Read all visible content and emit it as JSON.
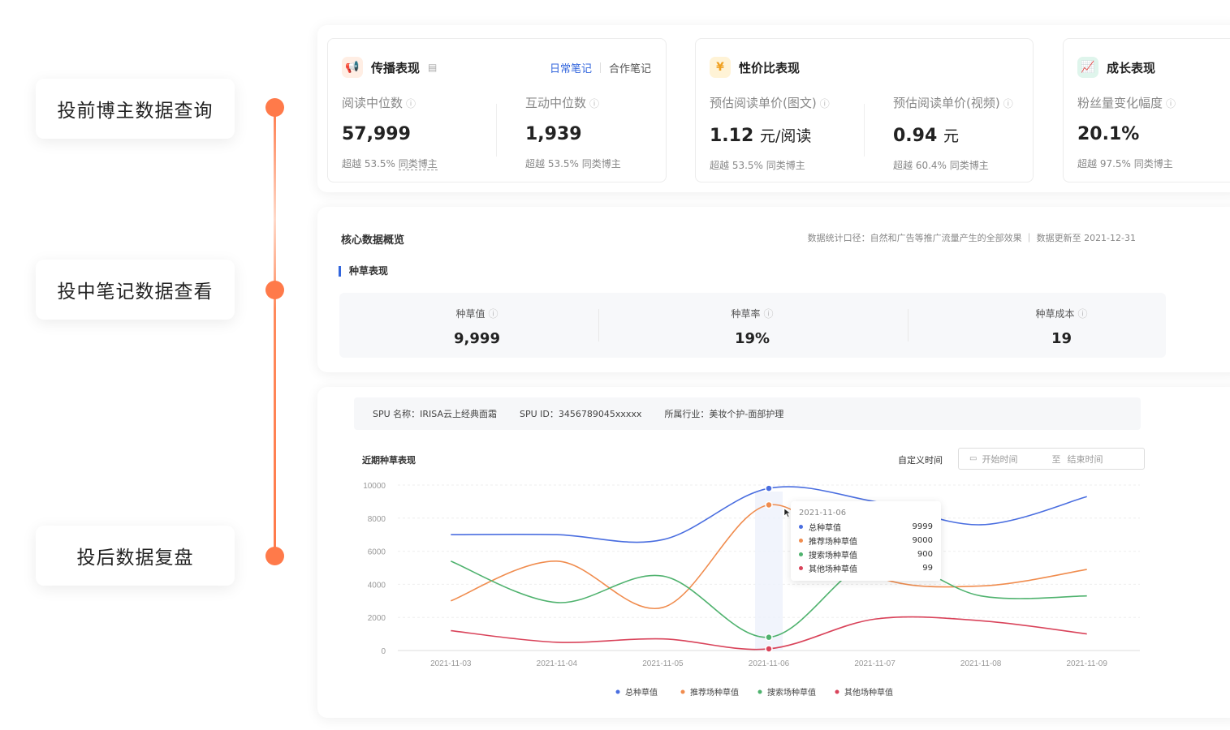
{
  "steps": [
    "投前博主数据查询",
    "投中笔记数据查看",
    "投后数据复盘"
  ],
  "cards": {
    "spread": {
      "title": "传播表现",
      "tab_active": "日常笔记",
      "tab_other": "合作笔记",
      "metrics": [
        {
          "label": "阅读中位数",
          "value": "57,999",
          "sub_prefix": "超越 53.5%",
          "sub_suffix": "同类博主"
        },
        {
          "label": "互动中位数",
          "value": "1,939",
          "sub_prefix": "超越 53.5%",
          "sub_suffix": "同类博主"
        }
      ]
    },
    "cost": {
      "title": "性价比表现",
      "icon": "¥",
      "metrics": [
        {
          "label": "预估阅读单价(图文)",
          "value": "1.12",
          "unit": "元/阅读",
          "sub_prefix": "超越 53.5%",
          "sub_suffix": "同类博主"
        },
        {
          "label": "预估阅读单价(视频)",
          "value": "0.94",
          "unit": "元",
          "sub_prefix": "超越 60.4%",
          "sub_suffix": "同类博主"
        }
      ]
    },
    "growth": {
      "title": "成长表现",
      "metrics": [
        {
          "label": "粉丝量变化幅度",
          "value": "20.1%",
          "sub_prefix": "超越 97.5%",
          "sub_suffix": "同类博主"
        }
      ]
    }
  },
  "core": {
    "title": "核心数据概览",
    "note": "数据统计口径：自然和广告等推广流量产生的全部效果 ｜ 数据更新至 2021-12-31",
    "section": "种草表现",
    "items": [
      {
        "label": "种草值",
        "value": "9,999"
      },
      {
        "label": "种草率",
        "value": "19%"
      },
      {
        "label": "种草成本",
        "value": "19"
      }
    ]
  },
  "spu": {
    "name": "SPU 名称：IRISA云上经典面霜",
    "id": "SPU ID：3456789045xxxxx",
    "industry": "所属行业：美妆个护-面部护理"
  },
  "chart_section": {
    "title": "近期种草表现",
    "time_label": "自定义时间",
    "start_placeholder": "开始时间",
    "to": "至",
    "end_placeholder": "结束时间"
  },
  "tooltip": {
    "date": "2021-11-06",
    "rows": [
      {
        "name": "总种草值",
        "value": "9999",
        "color": "#4a6ee0"
      },
      {
        "name": "推荐场种草值",
        "value": "9000",
        "color": "#f08c4e"
      },
      {
        "name": "搜索场种草值",
        "value": "900",
        "color": "#4fb26e"
      },
      {
        "name": "其他场种草值",
        "value": "99",
        "color": "#d9435a"
      }
    ]
  },
  "chart_data": {
    "type": "line",
    "x": [
      "2021-11-03",
      "2021-11-04",
      "2021-11-05",
      "2021-11-06",
      "2021-11-07",
      "2021-11-08",
      "2021-11-09"
    ],
    "ylim": [
      0,
      10000
    ],
    "yticks": [
      0,
      2000,
      4000,
      6000,
      8000,
      10000
    ],
    "grid": true,
    "legend_position": "bottom",
    "series": [
      {
        "name": "总种草值",
        "color": "#4a6ee0",
        "values": [
          7000,
          7000,
          6700,
          9800,
          9000,
          7600,
          9300
        ]
      },
      {
        "name": "推荐场种草值",
        "color": "#f08c4e",
        "values": [
          3000,
          5400,
          2600,
          8800,
          4500,
          3900,
          4900
        ]
      },
      {
        "name": "搜索场种草值",
        "color": "#4fb26e",
        "values": [
          5400,
          2900,
          4500,
          800,
          5500,
          3300,
          3300
        ]
      },
      {
        "name": "其他场种草值",
        "color": "#d9435a",
        "values": [
          1200,
          500,
          700,
          100,
          1900,
          1800,
          1000
        ]
      }
    ]
  }
}
